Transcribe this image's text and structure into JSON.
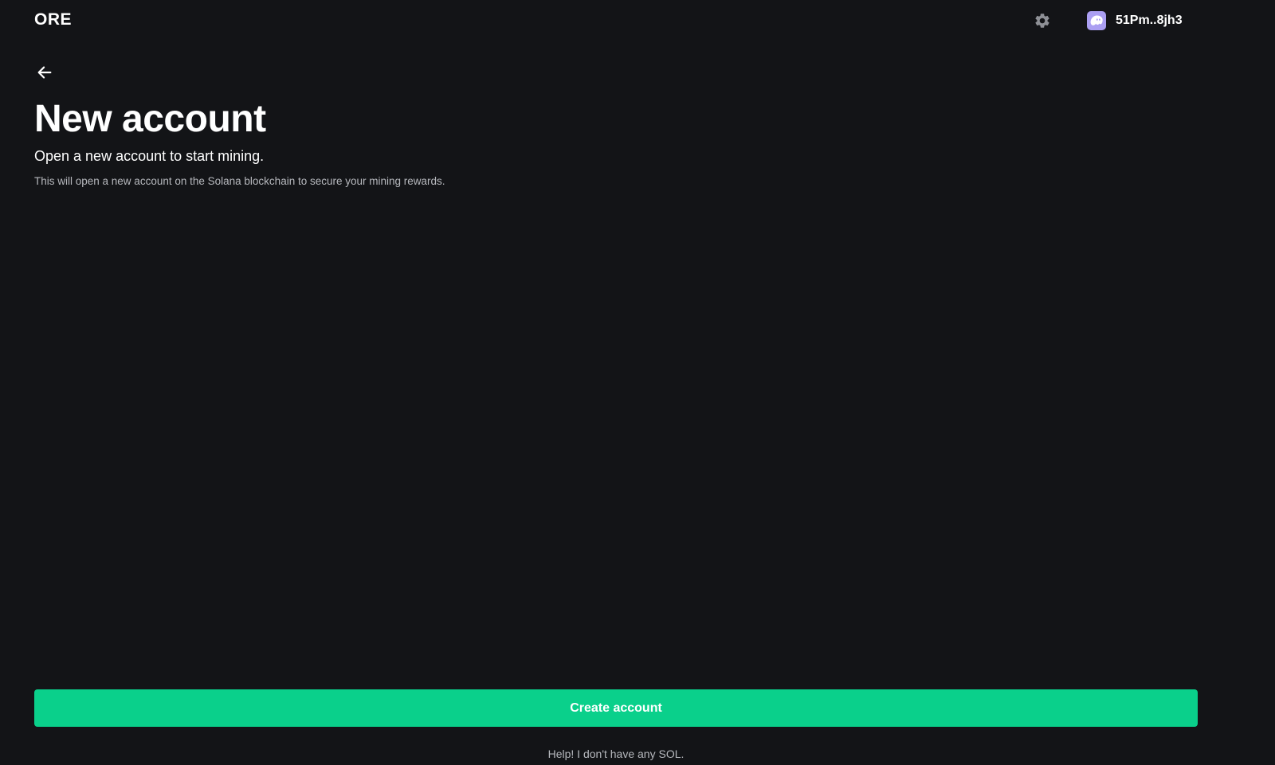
{
  "header": {
    "logo_text": "ORE",
    "settings_icon": "gear-icon",
    "wallet": {
      "avatar_icon": "phantom-ghost-icon",
      "address": "51Pm..8jh3"
    }
  },
  "main": {
    "back_icon": "arrow-left-icon",
    "title": "New account",
    "subtitle": "Open a new account to start mining.",
    "description": "This will open a new account on the Solana blockchain to secure your mining rewards.",
    "create_button_label": "Create account",
    "help_link_text": "Help! I don't have any SOL."
  },
  "colors": {
    "background": "#131417",
    "accent": "#0ad08b",
    "avatar": "#ab9ff2",
    "muted_text": "#b6b8bd"
  }
}
